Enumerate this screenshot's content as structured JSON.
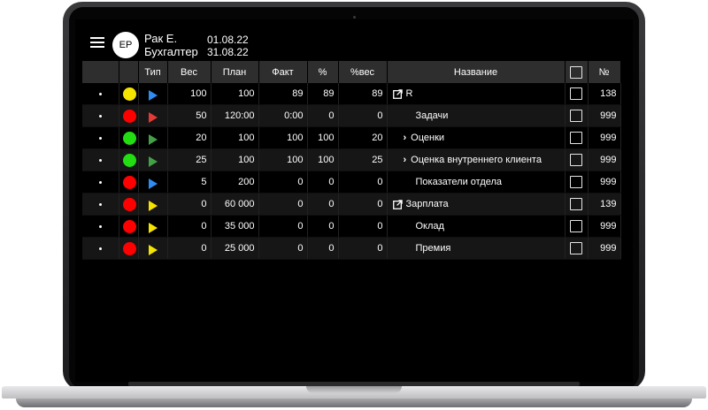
{
  "user": {
    "initials": "ЕР",
    "name": "Рак Е.",
    "role": "Бухгалтер"
  },
  "period": {
    "from": "01.08.22",
    "to": "31.08.22"
  },
  "table": {
    "headers": [
      "",
      "",
      "Тип",
      "Вес",
      "План",
      "Факт",
      "%",
      "%вес",
      "Название",
      "",
      "№"
    ],
    "rows": [
      {
        "status_color": "#f5e400",
        "type_color": "#2f8df2",
        "weight": "100",
        "plan": "100",
        "fact": "89",
        "pct": "89",
        "pct_weight": "89",
        "name_icon": "external-link-icon",
        "name": "R",
        "indent": 0,
        "number": "138"
      },
      {
        "status_color": "#ff0000",
        "type_color": "#e53935",
        "weight": "50",
        "plan": "120:00",
        "fact": "0:00",
        "pct": "0",
        "pct_weight": "0",
        "name_icon": "",
        "name": "Задачи",
        "indent": 2,
        "number": "999"
      },
      {
        "status_color": "#22dd11",
        "type_color": "#43a047",
        "weight": "20",
        "plan": "100",
        "fact": "100",
        "pct": "100",
        "pct_weight": "20",
        "name_icon": "chevron-right-icon",
        "name": "Оценки",
        "indent": 1,
        "number": "999"
      },
      {
        "status_color": "#22dd11",
        "type_color": "#43a047",
        "weight": "25",
        "plan": "100",
        "fact": "100",
        "pct": "100",
        "pct_weight": "25",
        "name_icon": "chevron-right-icon",
        "name": "Оценка внутреннего клиента",
        "indent": 1,
        "number": "999"
      },
      {
        "status_color": "#ff0000",
        "type_color": "#2f8df2",
        "weight": "5",
        "plan": "200",
        "fact": "0",
        "pct": "0",
        "pct_weight": "0",
        "name_icon": "",
        "name": "Показатели отдела",
        "indent": 2,
        "number": "999"
      },
      {
        "status_color": "#ff0000",
        "type_color": "#f5e400",
        "weight": "0",
        "plan": "60 000",
        "fact": "0",
        "pct": "0",
        "pct_weight": "0",
        "name_icon": "external-link-icon",
        "name": "Зарплата",
        "indent": 0,
        "number": "139"
      },
      {
        "status_color": "#ff0000",
        "type_color": "#f5e400",
        "weight": "0",
        "plan": "35 000",
        "fact": "0",
        "pct": "0",
        "pct_weight": "0",
        "name_icon": "",
        "name": "Оклад",
        "indent": 2,
        "number": "999"
      },
      {
        "status_color": "#ff0000",
        "type_color": "#f5e400",
        "weight": "0",
        "plan": "25 000",
        "fact": "0",
        "pct": "0",
        "pct_weight": "0",
        "name_icon": "",
        "name": "Премия",
        "indent": 2,
        "number": "999"
      }
    ]
  }
}
